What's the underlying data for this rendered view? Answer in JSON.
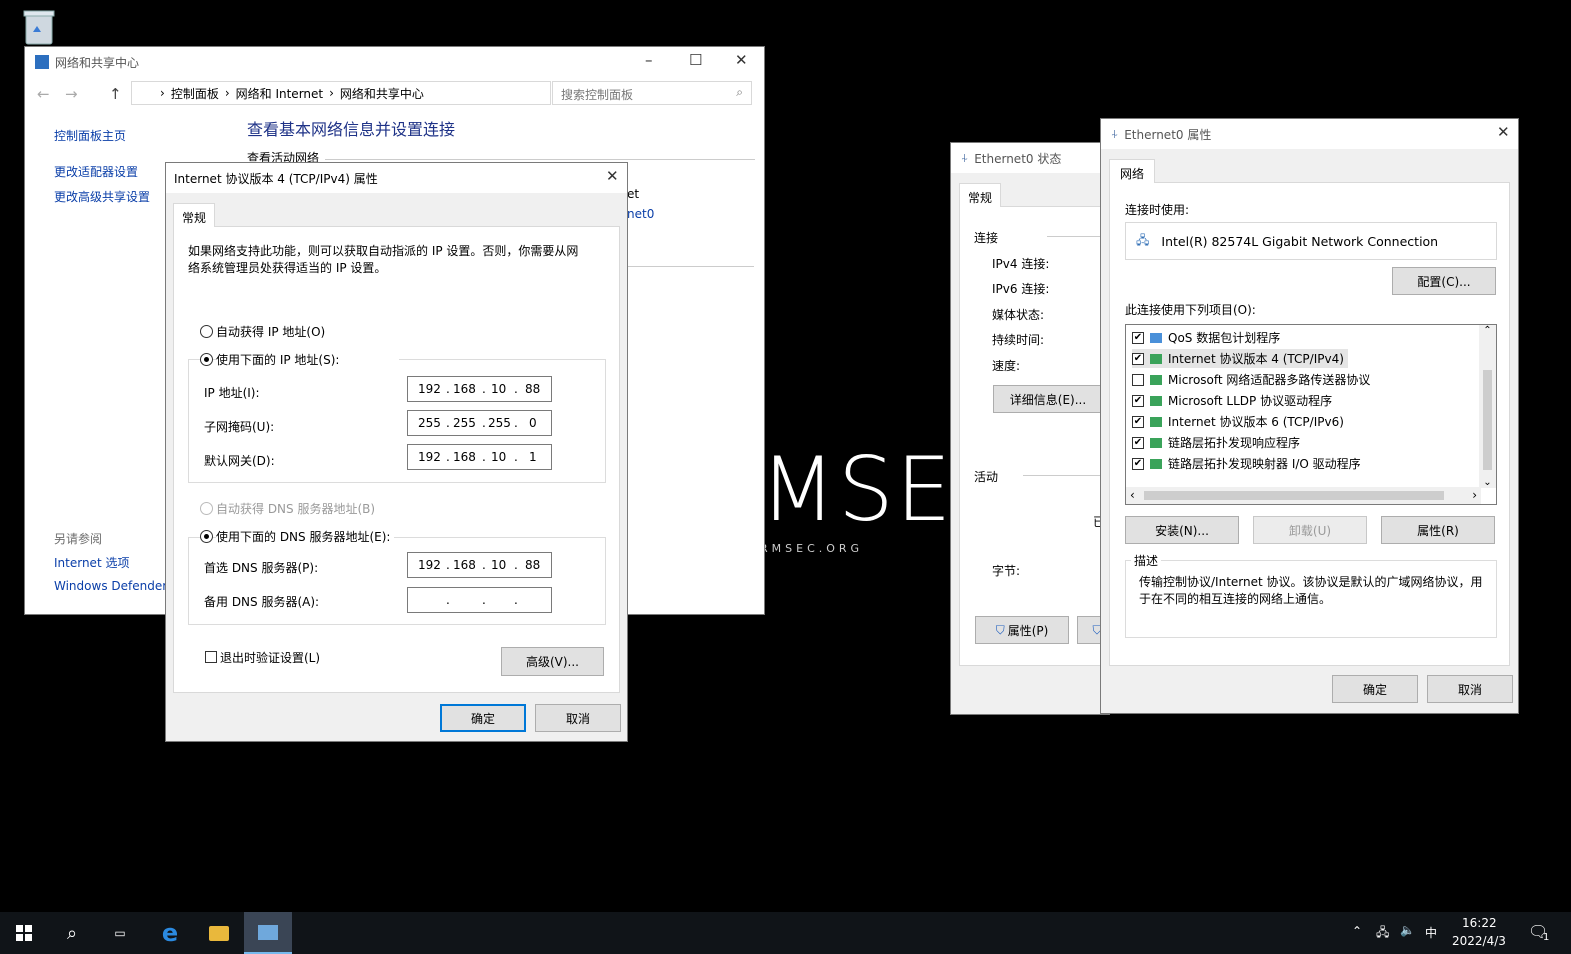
{
  "desktop": {
    "recycle_bin": "",
    "watermark": "MSEC",
    "watermark_sub": "RMSEC.ORG"
  },
  "nsc": {
    "title": "网络和共享中心",
    "breadcrumb": [
      "控制面板",
      "网络和 Internet",
      "网络和共享中心"
    ],
    "search_placeholder": "搜索控制面板",
    "side": {
      "home": "控制面板主页",
      "adapter": "更改适配器设置",
      "advanced": "更改高级共享设置",
      "see_also": "另请参阅",
      "internet_options": "Internet 选项",
      "defender": "Windows Defender"
    },
    "heading": "查看基本网络信息并设置连接",
    "active_net": "查看活动网络",
    "net_frag1": "et",
    "net_frag2": "net0"
  },
  "ipv4": {
    "title": "Internet 协议版本 4 (TCP/IPv4) 属性",
    "tab": "常规",
    "desc": "如果网络支持此功能，则可以获取自动指派的 IP 设置。否则，你需要从网络系统管理员处获得适当的 IP 设置。",
    "auto_ip": "自动获得 IP 地址(O)",
    "manual_ip": "使用下面的 IP 地址(S):",
    "ip_label": "IP 地址(I):",
    "mask_label": "子网掩码(U):",
    "gw_label": "默认网关(D):",
    "ip": [
      "192",
      "168",
      "10",
      "88"
    ],
    "mask": [
      "255",
      "255",
      "255",
      "0"
    ],
    "gw": [
      "192",
      "168",
      "10",
      "1"
    ],
    "auto_dns": "自动获得 DNS 服务器地址(B)",
    "manual_dns": "使用下面的 DNS 服务器地址(E):",
    "dns1_label": "首选 DNS 服务器(P):",
    "dns2_label": "备用 DNS 服务器(A):",
    "dns1": [
      "192",
      "168",
      "10",
      "88"
    ],
    "validate": "退出时验证设置(L)",
    "advanced": "高级(V)...",
    "ok": "确定",
    "cancel": "取消"
  },
  "status": {
    "title": "Ethernet0 状态",
    "tab": "常规",
    "conn": "连接",
    "ipv4": "IPv4 连接:",
    "ipv6": "IPv6 连接:",
    "media": "媒体状态:",
    "duration": "持续时间:",
    "speed": "速度:",
    "details": "详细信息(E)...",
    "activity": "活动",
    "sent_frag": "已",
    "bytes": "字节:",
    "props": "属性(P)"
  },
  "eth": {
    "title": "Ethernet0 属性",
    "tab": "网络",
    "connect_using": "连接时使用:",
    "adapter": "Intel(R) 82574L Gigabit Network Connection",
    "configure": "配置(C)...",
    "items_label": "此连接使用下列项目(O):",
    "items": [
      {
        "label": "QoS 数据包计划程序",
        "checked": true
      },
      {
        "label": "Internet 协议版本 4 (TCP/IPv4)",
        "checked": true
      },
      {
        "label": "Microsoft 网络适配器多路传送器协议",
        "checked": false
      },
      {
        "label": "Microsoft LLDP 协议驱动程序",
        "checked": true
      },
      {
        "label": "Internet 协议版本 6 (TCP/IPv6)",
        "checked": true
      },
      {
        "label": "链路层拓扑发现响应程序",
        "checked": true
      },
      {
        "label": "链路层拓扑发现映射器 I/O 驱动程序",
        "checked": true
      }
    ],
    "install": "安装(N)...",
    "uninstall": "卸载(U)",
    "properties": "属性(R)",
    "desc_title": "描述",
    "desc": "传输控制协议/Internet 协议。该协议是默认的广域网络协议，用于在不同的相互连接的网络上通信。",
    "ok": "确定",
    "cancel": "取消"
  },
  "taskbar": {
    "ime": "中",
    "time": "16:22",
    "date": "2022/4/3",
    "notif_count": "1"
  }
}
